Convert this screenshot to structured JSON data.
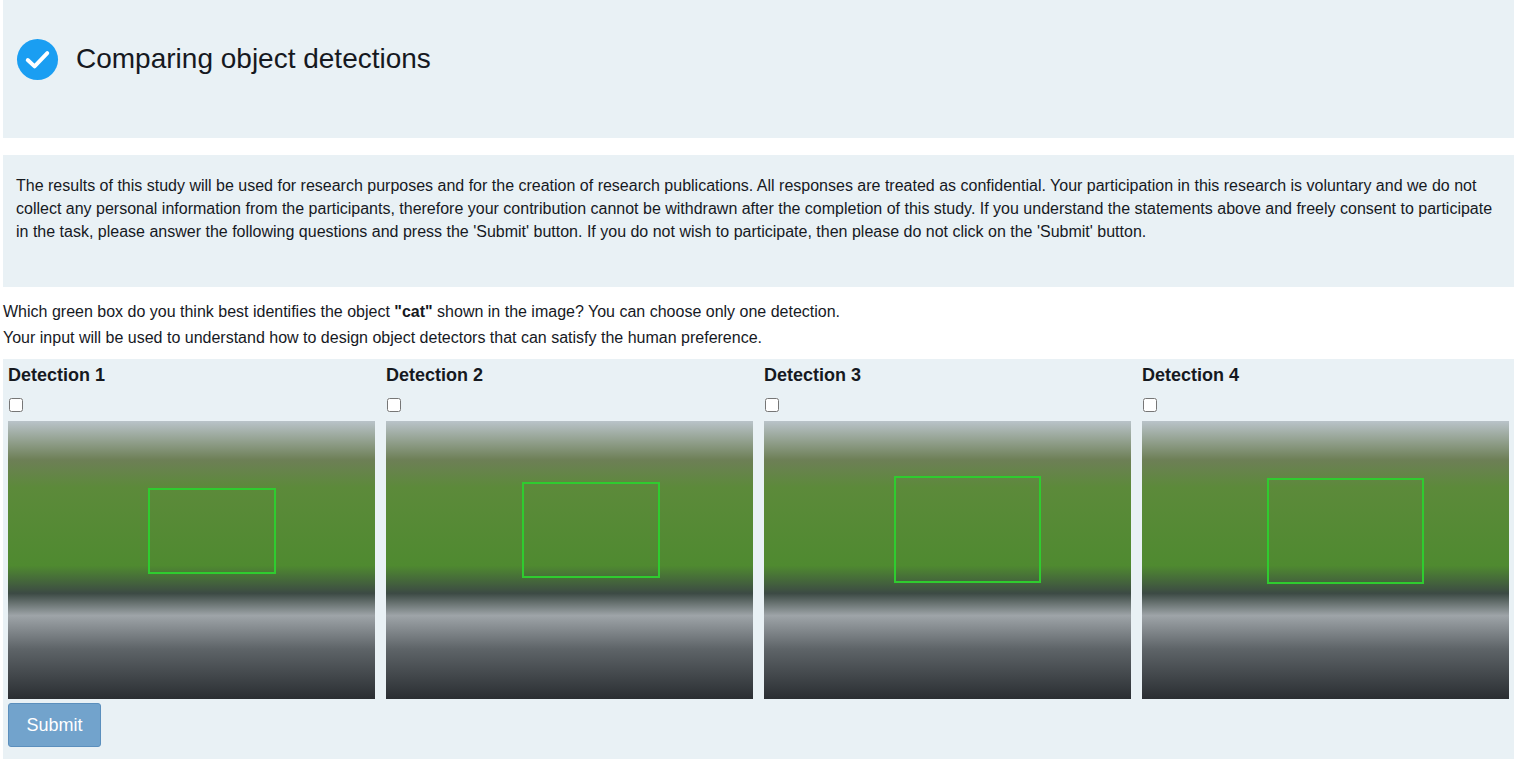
{
  "header": {
    "title": "Comparing object detections"
  },
  "consent": {
    "text": "The results of this study will be used for research purposes and for the creation of research publications. All responses are treated as confidential. Your participation in this research is voluntary and we do not collect any personal information from the participants, therefore your contribution cannot be withdrawn after the completion of this study. If you understand the statements above and freely consent to participate in the task, please answer the following questions and press the 'Submit' button. If you do not wish to participate, then please do not click on the 'Submit' button."
  },
  "question": {
    "before": "Which green box do you think best identifies the object ",
    "object": "\"cat\"",
    "after": " shown in the image? You can choose only one detection.",
    "note": "Your input will be used to understand how to design object detectors that can satisfy the human preference."
  },
  "detections": [
    {
      "label": "Detection 1",
      "checked": false,
      "box": [
        0.381,
        0.241,
        0.349,
        0.309
      ]
    },
    {
      "label": "Detection 2",
      "checked": false,
      "box": [
        0.371,
        0.219,
        0.376,
        0.345
      ]
    },
    {
      "label": "Detection 3",
      "checked": false,
      "box": [
        0.354,
        0.198,
        0.401,
        0.385
      ]
    },
    {
      "label": "Detection 4",
      "checked": false,
      "box": [
        0.341,
        0.205,
        0.428,
        0.381
      ]
    }
  ],
  "submit": {
    "label": "Submit",
    "disabled": true
  }
}
